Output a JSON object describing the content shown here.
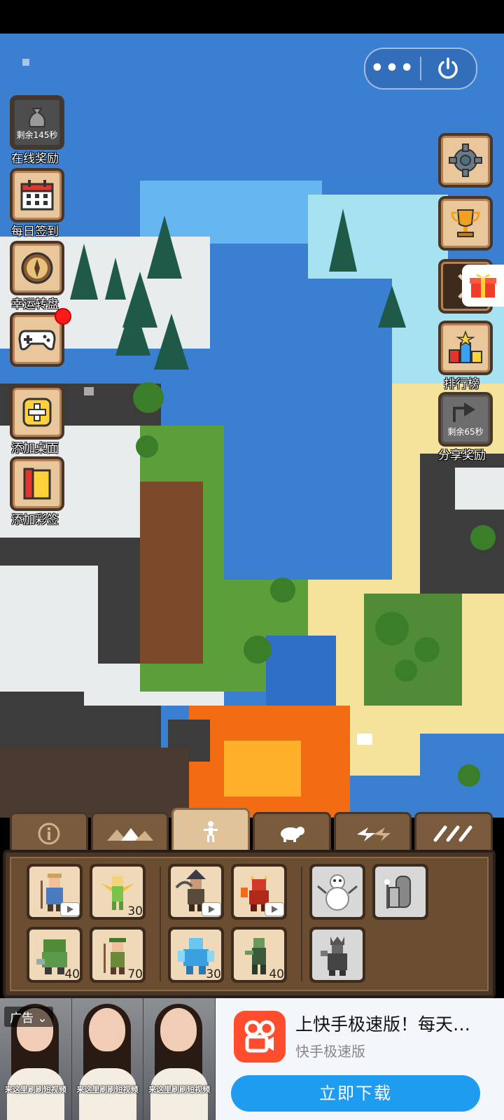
{
  "left_menu": [
    {
      "label": "在线奖励",
      "timer": "剩余145秒",
      "icon": "money-bag-icon"
    },
    {
      "label": "每日签到",
      "icon": "calendar-icon"
    },
    {
      "label": "幸运转盘",
      "icon": "wheel-icon"
    },
    {
      "label": "",
      "icon": "gamepad-icon",
      "badge": "red-dot"
    },
    {
      "label": "添加桌面",
      "icon": "plus-icon"
    },
    {
      "label": "添加彩签",
      "icon": "bookmark-icon"
    }
  ],
  "right_menu": [
    {
      "label": "",
      "icon": "gear-icon"
    },
    {
      "label": "",
      "icon": "trophy-icon"
    },
    {
      "label": "",
      "icon": "collapse-arrow-icon"
    },
    {
      "label": "排行榜",
      "icon": "leaderboard-icon"
    },
    {
      "label": "分享奖励",
      "timer": "剩余65秒",
      "icon": "share-icon"
    }
  ],
  "capsule": {
    "more": "•••",
    "power_icon": "power-icon"
  },
  "tabs": [
    "info-icon",
    "terrain-icon",
    "creatures-icon",
    "animals-icon",
    "disasters-icon",
    "tools-icon"
  ],
  "units": {
    "group1": [
      {
        "name": "farmer",
        "badge": "video"
      },
      {
        "name": "elf",
        "count": "30"
      },
      {
        "name": "dwarf",
        "count": "40"
      },
      {
        "name": "druid",
        "count": "70"
      }
    ],
    "group2": [
      {
        "name": "bandit",
        "badge": "video"
      },
      {
        "name": "demon",
        "badge": "video"
      },
      {
        "name": "ice-golem",
        "count": "30"
      },
      {
        "name": "zombie",
        "count": "40"
      }
    ],
    "group3": [
      {
        "name": "snowman"
      },
      {
        "name": "tombstone-ghost"
      },
      {
        "name": "evil-king"
      }
    ]
  },
  "ad": {
    "tag": "广告",
    "thumb_caption": "来这里刷刷短视频",
    "title": "上快手极速版！每天…",
    "subtitle": "快手极速版",
    "button": "立即下载"
  },
  "colors": {
    "ocean": "#3a7fd0",
    "sand": "#f5e39c",
    "grass": "#5b9e3a",
    "rock": "#3c3c3c",
    "snow": "#e9ecec",
    "lava": "#f36b12",
    "panel": "#6b4d32",
    "accent": "#1e9cf0"
  }
}
